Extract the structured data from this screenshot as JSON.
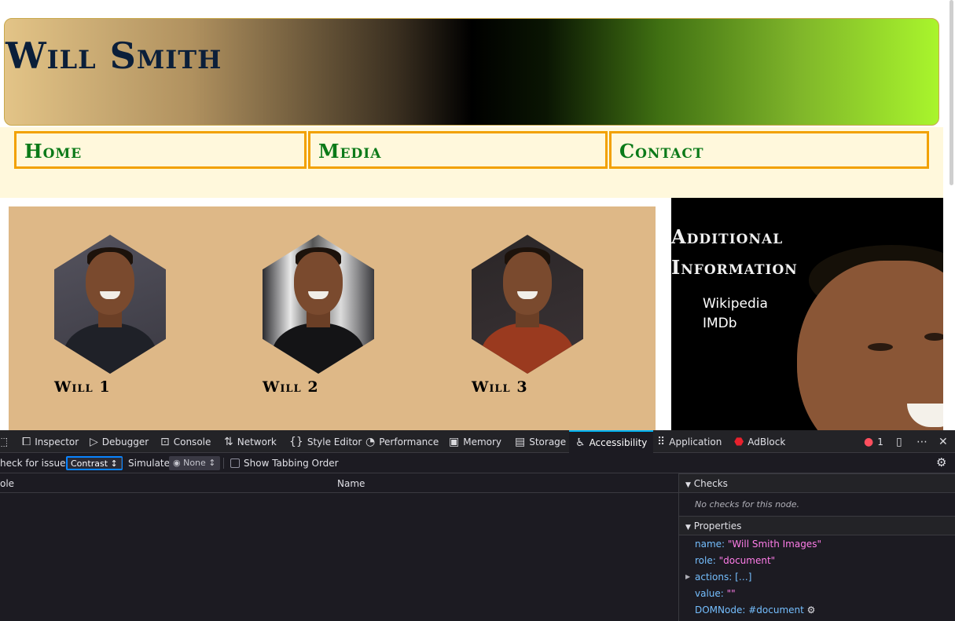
{
  "page": {
    "title": "Will Smith",
    "nav": [
      "Home",
      "Media",
      "Contact"
    ],
    "gallery": [
      {
        "caption": "Will 1"
      },
      {
        "caption": "Will 2"
      },
      {
        "caption": "Will 3"
      }
    ],
    "aside": {
      "title": "Additional Information",
      "links": [
        "Wikipedia",
        "IMDb"
      ]
    }
  },
  "devtools": {
    "tabs": [
      "Inspector",
      "Debugger",
      "Console",
      "Network",
      "Style Editor",
      "Performance",
      "Memory",
      "Storage",
      "Accessibility",
      "Application",
      "AdBlock"
    ],
    "active_tab": "Accessibility",
    "error_count": "1",
    "toolbar": {
      "check_label": "heck for issues:",
      "check_value": "Contrast ↕",
      "simulate_label": "Simulate:",
      "simulate_value": "◉ None ↕",
      "tabbing_label": "Show Tabbing Order"
    },
    "tree_columns": {
      "role": "ole",
      "name": "Name"
    },
    "sidebar": {
      "checks_title": "Checks",
      "checks_empty": "No checks for this node.",
      "properties_title": "Properties",
      "properties": [
        {
          "key": "name:",
          "value": "\"Will Smith Images\""
        },
        {
          "key": "role:",
          "value": "\"document\""
        },
        {
          "key": "actions:",
          "value": "[…]"
        },
        {
          "key": "value:",
          "value": "\"\""
        },
        {
          "key": "DOMNode:",
          "value": "#document"
        }
      ]
    },
    "colors": {
      "accent": "#00b3f4",
      "focus": "#0a84ff",
      "error": "#ff4f5e"
    }
  }
}
